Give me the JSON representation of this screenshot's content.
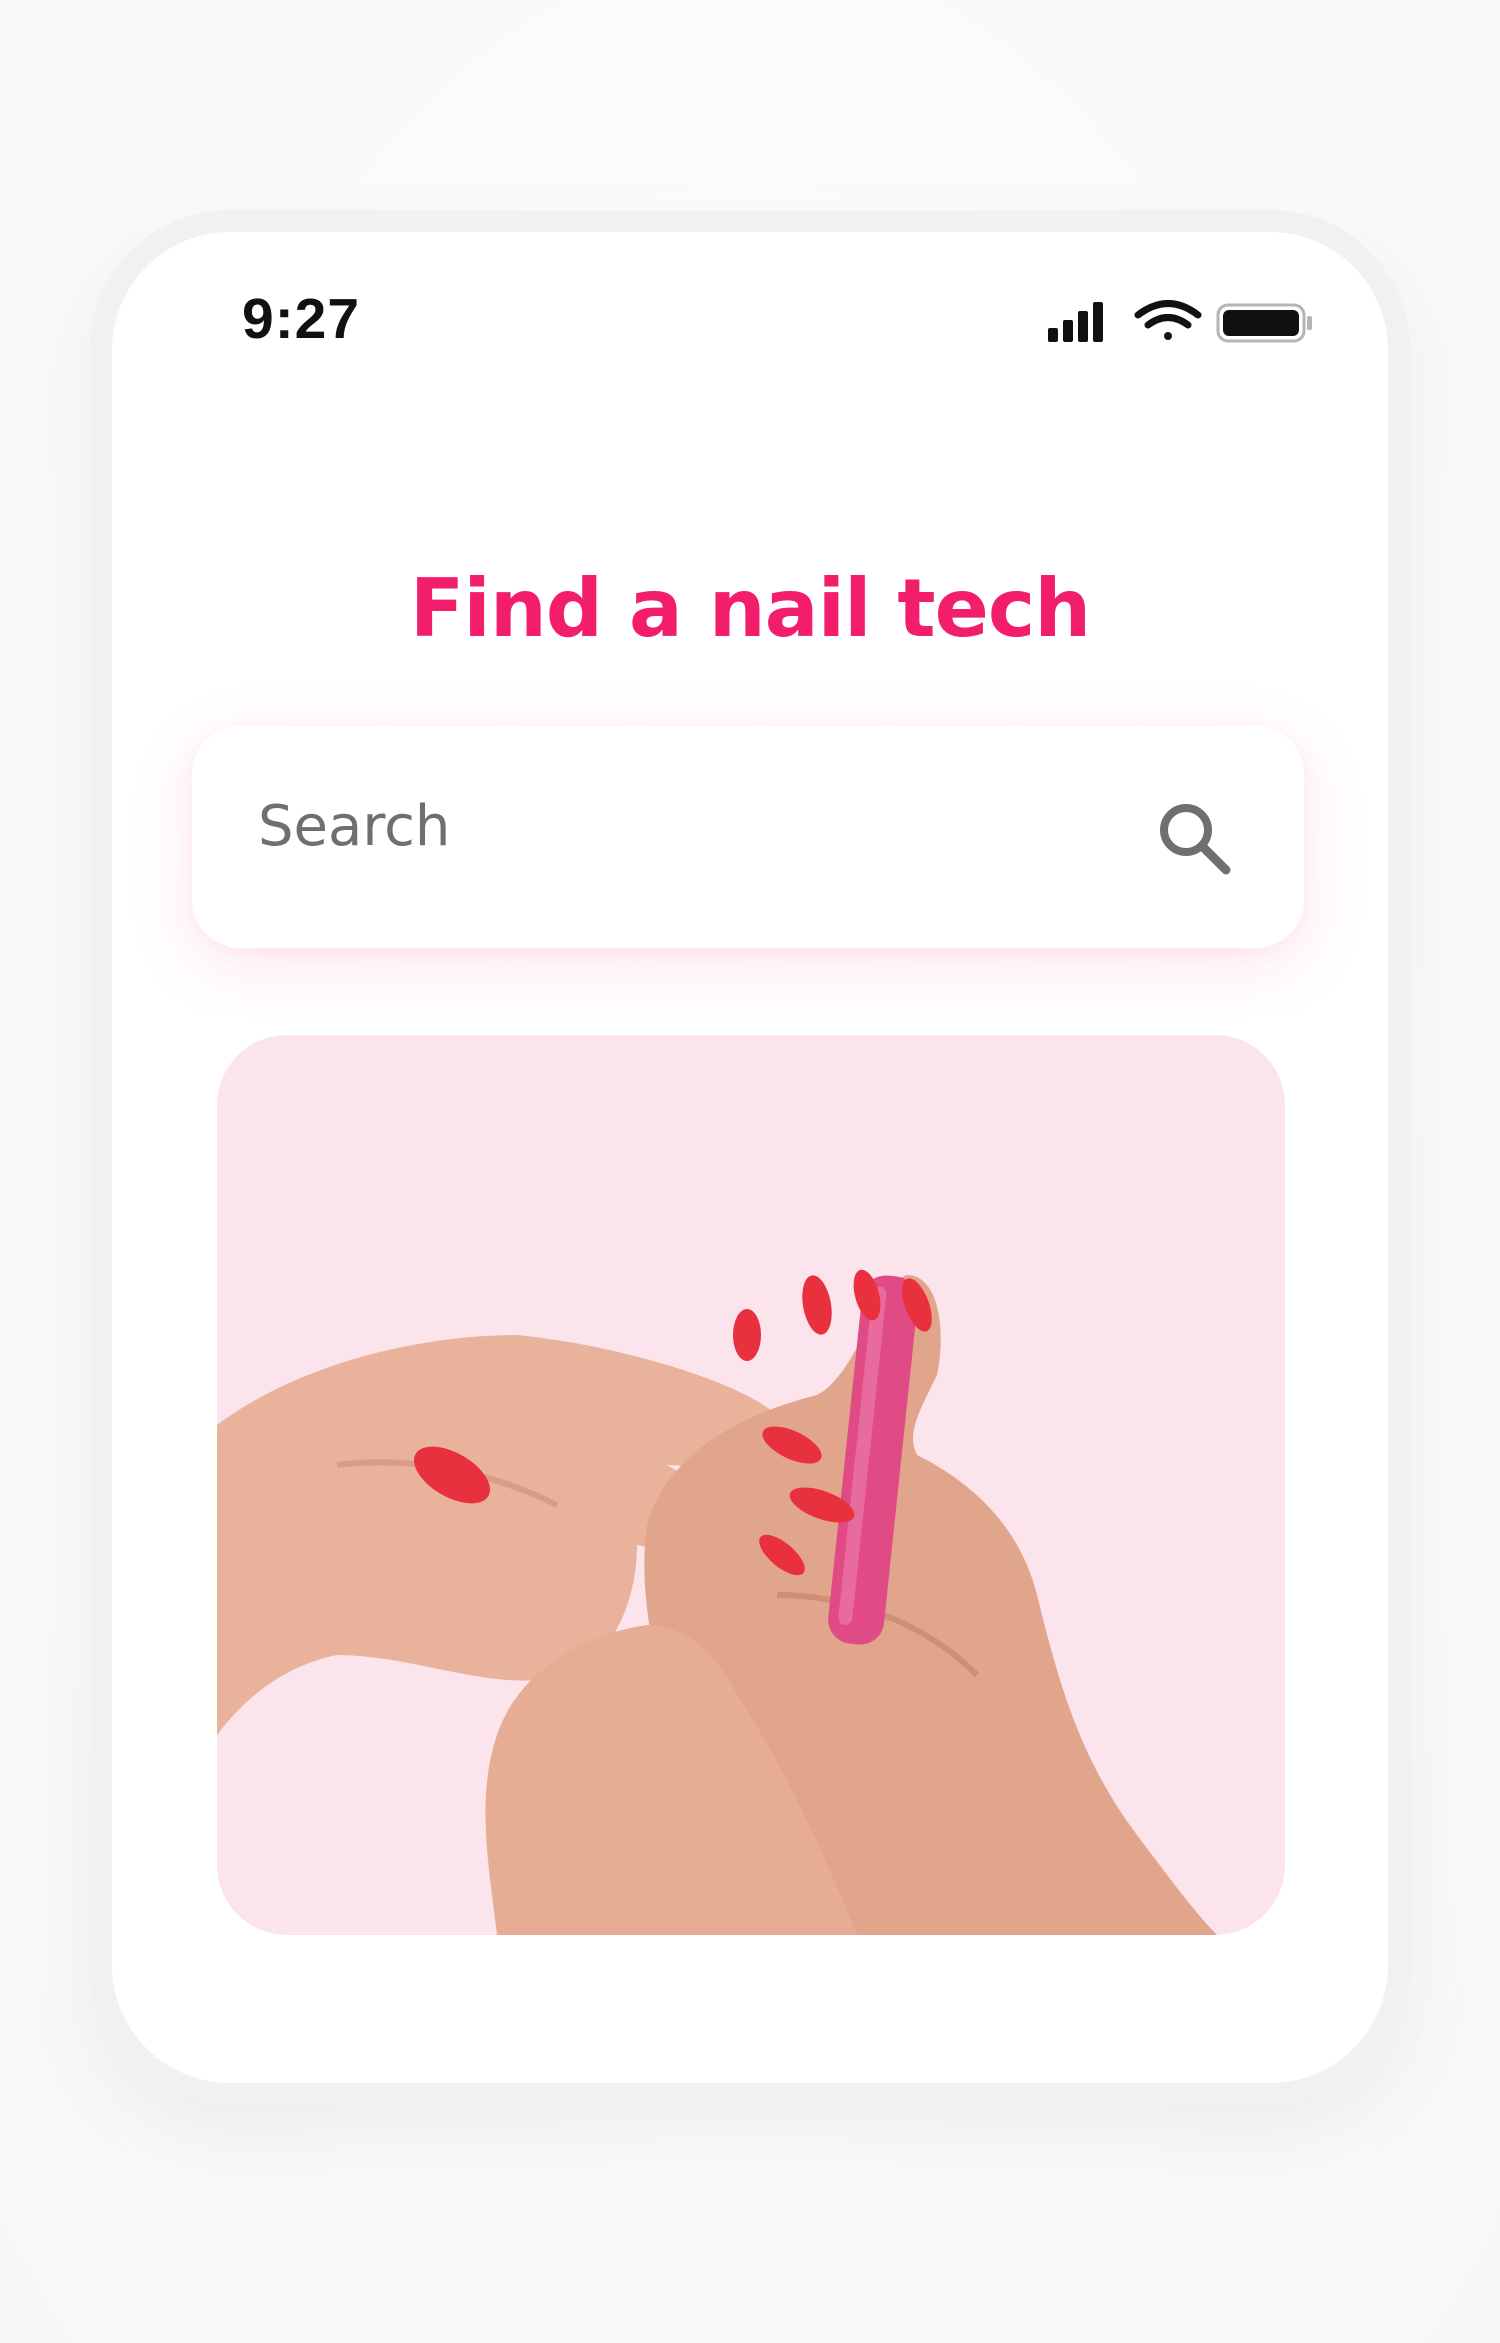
{
  "status_bar": {
    "time": "9:27",
    "icons": [
      "cellular-signal-icon",
      "wifi-icon",
      "battery-icon"
    ]
  },
  "header": {
    "title": "Find a nail tech"
  },
  "search": {
    "placeholder": "Search",
    "icon": "search-icon"
  },
  "hero": {
    "image": "hands-with-red-nails-and-pink-nail-file"
  },
  "colors": {
    "accent": "#f21d6b",
    "hero_background": "#fbe4ec",
    "nail_red": "#e8303f",
    "nail_file": "#e04b86"
  }
}
